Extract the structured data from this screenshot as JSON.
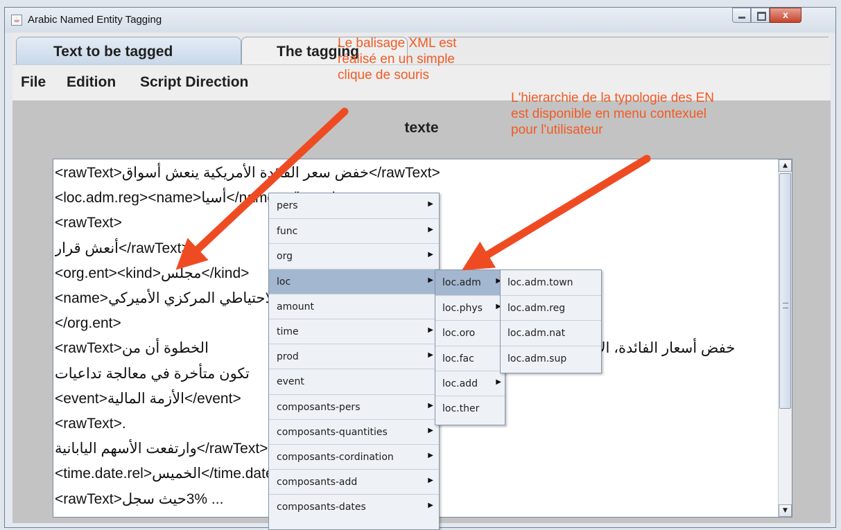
{
  "window": {
    "title": "Arabic Named Entity Tagging",
    "close_label": "x"
  },
  "tabs": [
    {
      "label": "Text to be tagged",
      "selected": true
    },
    {
      "label": "The tagging",
      "selected": false
    }
  ],
  "menubar": [
    "File",
    "Edition",
    "Script Direction"
  ],
  "panel": {
    "title": "texte"
  },
  "editor_lines": [
    {
      "ltr": "<rawText>",
      "rtl": "خفض سعر الفائدة الأمريكية ينعش أسواق",
      "tail": " </rawText>"
    },
    {
      "ltr": "<loc.adm.reg><name>",
      "rtl": "أسيا",
      "tail": "</name></loc.adm.reg>"
    },
    {
      "ltr": "<rawText>",
      "rtl": "",
      "tail": ""
    },
    {
      "ltr": "",
      "rtl": "أنعش قرار",
      "tail": " </rawText>"
    },
    {
      "ltr": "<org.ent><kind>",
      "rtl": "مجلس",
      "tail": "</kind>"
    },
    {
      "ltr": "<name>",
      "rtl": "الاحتياطي المركزي الأميركي",
      "tail": "- <name>"
    },
    {
      "ltr": "</org.ent>",
      "rtl": "",
      "tail": ""
    },
    {
      "ltr": "<rawText>",
      "rtl": "الخطوة أن من",
      "tail": "",
      "right": "خفض أسعار الفائدة، الأسواق"
    },
    {
      "ltr": "",
      "rtl": "تكون متأخرة في معالجة تداعيات",
      "tail": ""
    },
    {
      "ltr": "<event>",
      "rtl": "الأزمة المالية",
      "tail": "</event>"
    },
    {
      "ltr": "<rawText>.",
      "rtl": "",
      "tail": ""
    },
    {
      "ltr": "",
      "rtl": "وارتفعت الأسهم اليابانية",
      "tail": " </rawText>"
    },
    {
      "ltr": "<time.date.rel>",
      "rtl": "الخميس",
      "tail": "</time.date.rel>"
    },
    {
      "ltr": "<rawText>",
      "rtl": "حيث سجل",
      "tail": " 3% ..."
    }
  ],
  "context_menu": {
    "level1": [
      "pers",
      "func",
      "org",
      "loc",
      "amount",
      "time",
      "prod",
      "event",
      "composants-pers",
      "composants-quantities",
      "composants-cordination",
      "composants-add",
      "composants-dates"
    ],
    "level1_submenu": [
      true,
      true,
      true,
      true,
      false,
      true,
      true,
      false,
      true,
      true,
      true,
      true,
      true
    ],
    "level1_selected": "loc",
    "level2": [
      "loc.adm",
      "loc.phys",
      "loc.oro",
      "loc.fac",
      "loc.add",
      "loc.ther"
    ],
    "level2_submenu": [
      true,
      true,
      false,
      false,
      true,
      false
    ],
    "level2_selected": "loc.adm",
    "level3": [
      "loc.adm.town",
      "loc.adm.reg",
      "loc.adm.nat",
      "loc.adm.sup"
    ]
  },
  "annotations": [
    {
      "lines": [
        "Le balisage XML est",
        "réalisé en un simple",
        "clique de souris"
      ]
    },
    {
      "lines": [
        "L'hierarchie de la typologie des EN",
        "est disponible en menu contexuel",
        "pour l'utilisateur"
      ]
    }
  ],
  "colors": {
    "annotation": "#f15a24",
    "selection": "#a4b7d0",
    "tab_selected": "#c9d8e8"
  },
  "icons": {
    "app": "java-icon",
    "submenu": "submenu-arrow-icon"
  }
}
